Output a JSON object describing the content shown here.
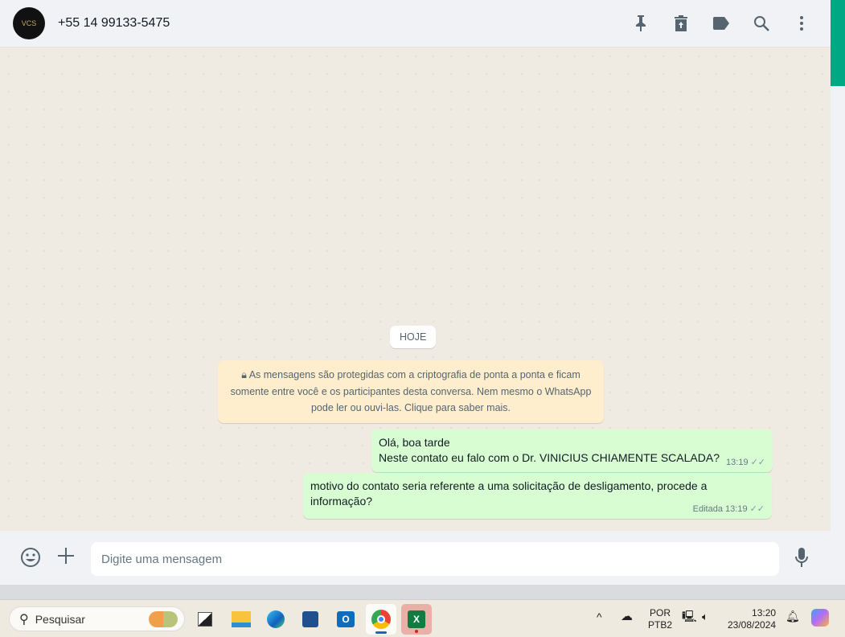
{
  "header": {
    "contact": "+55 14 99133-5475",
    "avatar_text": "VCS",
    "icons": [
      "pin-icon",
      "trash-icon",
      "label-icon",
      "search-icon",
      "menu-icon"
    ]
  },
  "chat": {
    "date_label": "HOJE",
    "encryption_notice": "As mensagens são protegidas com a criptografia de ponta a ponta e ficam somente entre você e os participantes desta conversa. Nem mesmo o WhatsApp pode ler ou ouvi-las. Clique para saber mais.",
    "messages": [
      {
        "line1": "Olá, boa tarde",
        "line2": "Neste contato eu falo com o Dr. VINICIUS CHIAMENTE SCALADA?",
        "time": "13:19",
        "status": "read"
      },
      {
        "text": "motivo do contato seria referente a uma solicitação de desligamento, procede a informação?",
        "edited": "Editada",
        "time": "13:19",
        "status": "read"
      }
    ]
  },
  "composer": {
    "placeholder": "Digite uma mensagem"
  },
  "taskbar": {
    "search": "Pesquisar",
    "lang1": "POR",
    "lang2": "PTB2",
    "time": "13:20",
    "date": "23/08/2024",
    "apps": [
      "task-view",
      "file-explorer",
      "edge",
      "store",
      "outlook",
      "chrome",
      "excel"
    ],
    "accent": "#00a884"
  }
}
